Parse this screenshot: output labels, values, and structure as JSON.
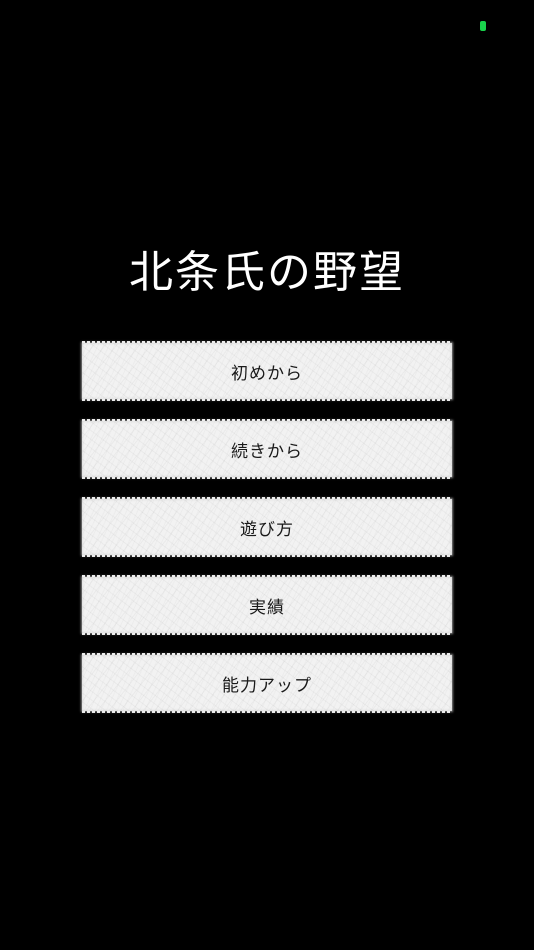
{
  "status": {
    "indicator_color": "#19d34c"
  },
  "title": "北条氏の野望",
  "menu": {
    "items": [
      {
        "label": "初めから"
      },
      {
        "label": "続きから"
      },
      {
        "label": "遊び方"
      },
      {
        "label": "実績"
      },
      {
        "label": "能力アップ"
      }
    ]
  }
}
